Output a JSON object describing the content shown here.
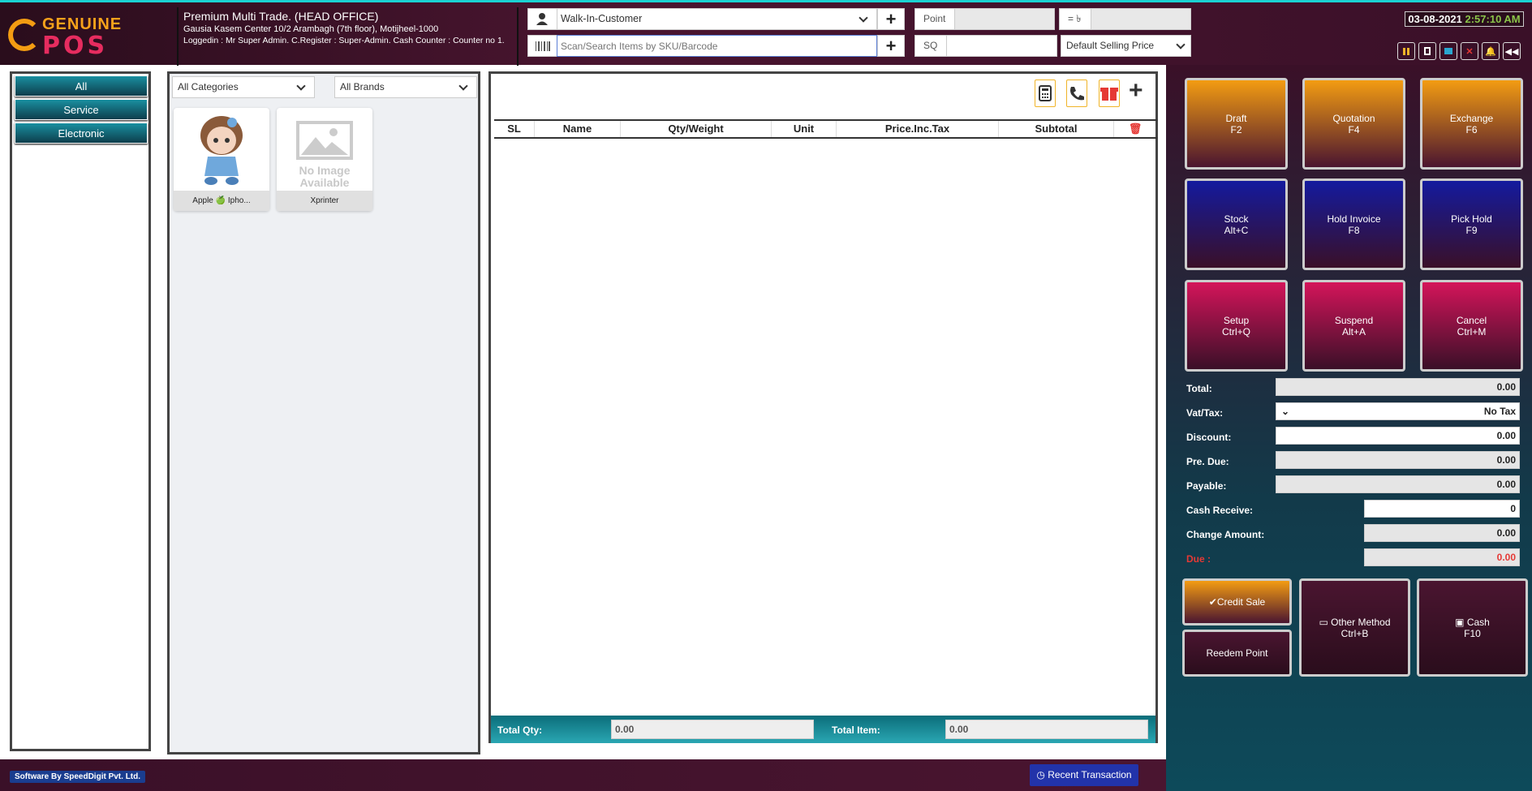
{
  "logo": {
    "line1": "GENUINE",
    "line2": "POS"
  },
  "company": {
    "title": "Premium Multi Trade. (HEAD OFFICE)",
    "address": "Gausia Kasem Center 10/2 Arambagh (7th floor), Motijheel-1000",
    "login": "Loggedin : Mr Super Admin. C.Register : Super-Admin. Cash Counter : Counter no 1."
  },
  "customer": {
    "value": "Walk-In-Customer"
  },
  "search": {
    "placeholder": "Scan/Search Items by SKU/Barcode"
  },
  "point": {
    "label": "Point",
    "value": "",
    "eq_label": "= ৳",
    "eq_value": ""
  },
  "sq": {
    "label": "SQ",
    "value": ""
  },
  "price_type": {
    "value": "Default Selling Price"
  },
  "datetime": {
    "date": "03-08-2021",
    "time": "2:57:10 AM"
  },
  "categories": [
    {
      "label": "All"
    },
    {
      "label": "Service"
    },
    {
      "label": "Electronic"
    }
  ],
  "filters": {
    "category": "All Categories",
    "brand": "All Brands"
  },
  "products": [
    {
      "name": "Apple 🍏 Ipho...",
      "image": "doll-photo"
    },
    {
      "name": "Xprinter",
      "image": "no-image",
      "no_image_text": "No Image Available"
    }
  ],
  "cart": {
    "columns": [
      "SL",
      "Name",
      "Qty/Weight",
      "Unit",
      "Price.Inc.Tax",
      "Subtotal"
    ],
    "rows": [],
    "total_qty_label": "Total Qty:",
    "total_qty": "0.00",
    "total_item_label": "Total Item:",
    "total_item": "0.00"
  },
  "function_buttons": [
    {
      "label": "Draft",
      "key": "F2",
      "color": "orange"
    },
    {
      "label": "Quotation",
      "key": "F4",
      "color": "orange"
    },
    {
      "label": "Exchange",
      "key": "F6",
      "color": "orange"
    },
    {
      "label": "Stock",
      "key": "Alt+C",
      "color": "blue"
    },
    {
      "label": "Hold Invoice",
      "key": "F8",
      "color": "blue"
    },
    {
      "label": "Pick Hold",
      "key": "F9",
      "color": "blue"
    },
    {
      "label": "Setup",
      "key": "Ctrl+Q",
      "color": "pink"
    },
    {
      "label": "Suspend",
      "key": "Alt+A",
      "color": "pink"
    },
    {
      "label": "Cancel",
      "key": "Ctrl+M",
      "color": "pink"
    }
  ],
  "summary": {
    "total_label": "Total:",
    "total": "0.00",
    "vat_label": "Vat/Tax:",
    "vat": "No Tax",
    "discount_label": "Discount:",
    "discount": "0.00",
    "pre_due_label": "Pre. Due:",
    "pre_due": "0.00",
    "payable_label": "Payable:",
    "payable": "0.00",
    "cash_receive_label": "Cash Receive:",
    "cash_receive": "0",
    "change_label": "Change Amount:",
    "change": "0.00",
    "due_label": "Due :",
    "due": "0.00"
  },
  "payment": {
    "credit_sale": "Credit Sale",
    "redeem_point": "Reedem Point",
    "other_method": "Other Method",
    "other_key": "Ctrl+B",
    "cash": "Cash",
    "cash_key": "F10"
  },
  "footer": {
    "brand": "Software By SpeedDigit Pvt. Ltd.",
    "recent": "Recent Transaction"
  },
  "colors": {
    "accent_orange": "#f39c12",
    "accent_pink": "#d4145a",
    "accent_blue": "#141a9e",
    "teal": "#0b6d7a",
    "due_red": "#e53935",
    "time_green": "#8bc34a"
  }
}
